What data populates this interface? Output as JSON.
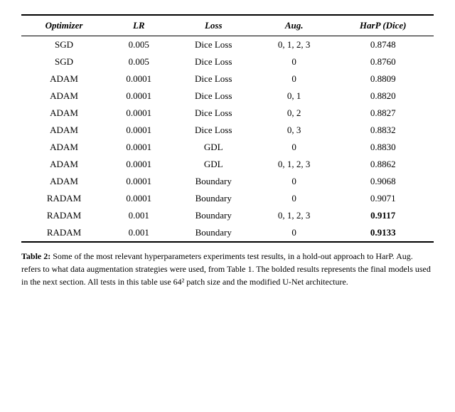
{
  "table": {
    "columns": [
      "Optimizer",
      "LR",
      "Loss",
      "Aug.",
      "HarP (Dice)"
    ],
    "rows": [
      {
        "optimizer": "SGD",
        "lr": "0.005",
        "loss": "Dice Loss",
        "aug": "0, 1, 2, 3",
        "harp": "0.8748",
        "bold": false
      },
      {
        "optimizer": "SGD",
        "lr": "0.005",
        "loss": "Dice Loss",
        "aug": "0",
        "harp": "0.8760",
        "bold": false
      },
      {
        "optimizer": "ADAM",
        "lr": "0.0001",
        "loss": "Dice Loss",
        "aug": "0",
        "harp": "0.8809",
        "bold": false
      },
      {
        "optimizer": "ADAM",
        "lr": "0.0001",
        "loss": "Dice Loss",
        "aug": "0, 1",
        "harp": "0.8820",
        "bold": false
      },
      {
        "optimizer": "ADAM",
        "lr": "0.0001",
        "loss": "Dice Loss",
        "aug": "0, 2",
        "harp": "0.8827",
        "bold": false
      },
      {
        "optimizer": "ADAM",
        "lr": "0.0001",
        "loss": "Dice Loss",
        "aug": "0, 3",
        "harp": "0.8832",
        "bold": false
      },
      {
        "optimizer": "ADAM",
        "lr": "0.0001",
        "loss": "GDL",
        "aug": "0",
        "harp": "0.8830",
        "bold": false
      },
      {
        "optimizer": "ADAM",
        "lr": "0.0001",
        "loss": "GDL",
        "aug": "0, 1, 2, 3",
        "harp": "0.8862",
        "bold": false
      },
      {
        "optimizer": "ADAM",
        "lr": "0.0001",
        "loss": "Boundary",
        "aug": "0",
        "harp": "0.9068",
        "bold": false
      },
      {
        "optimizer": "RADAM",
        "lr": "0.0001",
        "loss": "Boundary",
        "aug": "0",
        "harp": "0.9071",
        "bold": false
      },
      {
        "optimizer": "RADAM",
        "lr": "0.001",
        "loss": "Boundary",
        "aug": "0, 1, 2, 3",
        "harp": "0.9117",
        "bold": true
      },
      {
        "optimizer": "RADAM",
        "lr": "0.001",
        "loss": "Boundary",
        "aug": "0",
        "harp": "0.9133",
        "bold": true
      }
    ]
  },
  "caption": {
    "label": "Table 2:",
    "text": " Some of the most relevant hyperparameters experiments test results, in a hold-out approach to HarP. Aug. refers to what data augmentation strategies were used, from Table 1. The bolded results represents the final models used in the next section. All tests in this table use 64² patch size and the modified U-Net architecture."
  }
}
